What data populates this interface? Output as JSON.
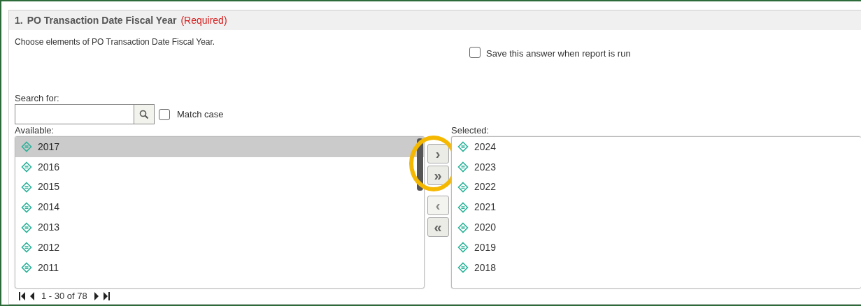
{
  "panel": {
    "number": "1.",
    "title": "PO Transaction Date Fiscal Year",
    "required_label": "(Required)",
    "description": "Choose elements of PO Transaction Date Fiscal Year.",
    "save_answer": {
      "label": "Save this answer when report is run",
      "checked": false
    },
    "search": {
      "label": "Search for:",
      "match_case": {
        "label": "Match case",
        "checked": false
      }
    },
    "available": {
      "label": "Available:",
      "items": [
        {
          "label": "2017",
          "selected": true
        },
        {
          "label": "2016",
          "selected": false
        },
        {
          "label": "2015",
          "selected": false
        },
        {
          "label": "2014",
          "selected": false
        },
        {
          "label": "2013",
          "selected": false
        },
        {
          "label": "2012",
          "selected": false
        },
        {
          "label": "2011",
          "selected": false
        }
      ]
    },
    "move_buttons": [
      {
        "symbol": "›",
        "disabled": false
      },
      {
        "symbol": "»",
        "disabled": false
      },
      {
        "symbol": "‹",
        "disabled": true
      },
      {
        "symbol": "«",
        "disabled": false
      }
    ],
    "highlight": {
      "kind": "ellipse",
      "color": "#f5b800"
    },
    "selected": {
      "label": "Selected:",
      "items": [
        {
          "label": "2024",
          "selected": false
        },
        {
          "label": "2023",
          "selected": false
        },
        {
          "label": "2022",
          "selected": false
        },
        {
          "label": "2021",
          "selected": false
        },
        {
          "label": "2020",
          "selected": false
        },
        {
          "label": "2019",
          "selected": false
        },
        {
          "label": "2018",
          "selected": false
        }
      ]
    },
    "pager": {
      "text": "1 - 30 of 78"
    }
  }
}
